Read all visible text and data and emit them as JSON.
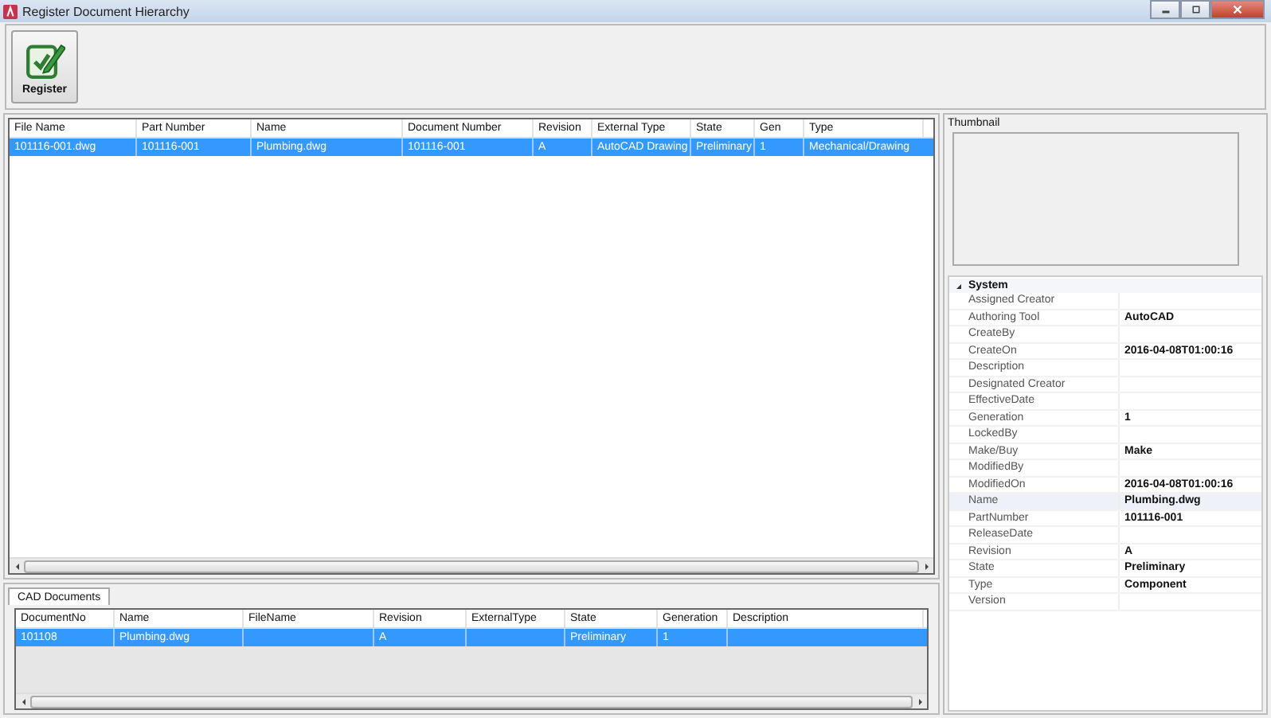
{
  "window": {
    "title": "Register Document Hierarchy"
  },
  "toolbar": {
    "buttons": [
      {
        "label": "Register"
      }
    ]
  },
  "documents_table": {
    "columns": [
      "File Name",
      "Part Number",
      "Name",
      "Document Number",
      "Revision",
      "External Type",
      "State",
      "Gen",
      "Type"
    ],
    "rows": [
      {
        "selected": true,
        "cells": [
          "101116-001.dwg",
          "101116-001",
          "Plumbing.dwg",
          "101116-001",
          "A",
          "AutoCAD Drawing",
          "Preliminary",
          "1",
          "Mechanical/Drawing"
        ]
      }
    ]
  },
  "tabs": [
    {
      "label": "CAD Documents",
      "selected": true
    }
  ],
  "cad_table": {
    "columns": [
      "DocumentNo",
      "Name",
      "FileName",
      "Revision",
      "ExternalType",
      "State",
      "Generation",
      "Description"
    ],
    "rows": [
      {
        "selected": true,
        "cells": [
          "101108",
          "Plumbing.dwg",
          "",
          "A",
          "",
          "Preliminary",
          "1",
          ""
        ]
      }
    ]
  },
  "thumbnail": {
    "label": "Thumbnail"
  },
  "properties": {
    "category": "System",
    "expanded": true,
    "items": [
      {
        "name": "Assigned Creator",
        "value": "",
        "selected": false
      },
      {
        "name": "Authoring Tool",
        "value": "AutoCAD",
        "selected": false
      },
      {
        "name": "CreateBy",
        "value": "",
        "selected": false
      },
      {
        "name": "CreateOn",
        "value": "2016-04-08T01:00:16",
        "selected": false
      },
      {
        "name": "Description",
        "value": "",
        "selected": false
      },
      {
        "name": "Designated Creator",
        "value": "",
        "selected": false
      },
      {
        "name": "EffectiveDate",
        "value": "",
        "selected": false
      },
      {
        "name": "Generation",
        "value": "1",
        "selected": false
      },
      {
        "name": "LockedBy",
        "value": "",
        "selected": false
      },
      {
        "name": "Make/Buy",
        "value": "Make",
        "selected": false
      },
      {
        "name": "ModifiedBy",
        "value": "",
        "selected": false
      },
      {
        "name": "ModifiedOn",
        "value": "2016-04-08T01:00:16",
        "selected": false
      },
      {
        "name": "Name",
        "value": "Plumbing.dwg",
        "selected": true
      },
      {
        "name": "PartNumber",
        "value": "101116-001",
        "selected": false
      },
      {
        "name": "ReleaseDate",
        "value": "",
        "selected": false
      },
      {
        "name": "Revision",
        "value": "A",
        "selected": false
      },
      {
        "name": "State",
        "value": "Preliminary",
        "selected": false
      },
      {
        "name": "Type",
        "value": "Component",
        "selected": false
      },
      {
        "name": "Version",
        "value": "",
        "selected": false
      }
    ]
  }
}
